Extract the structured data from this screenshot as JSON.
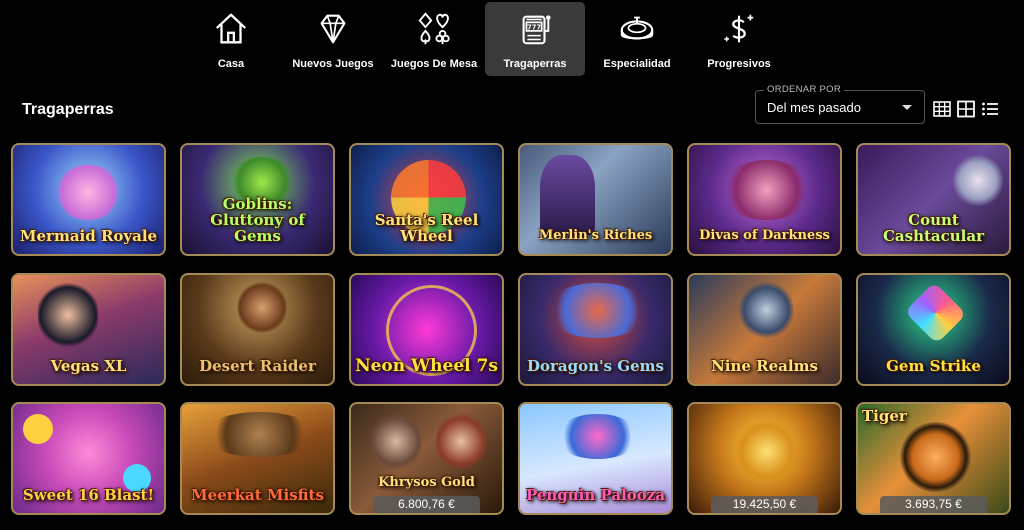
{
  "nav": {
    "items": [
      {
        "label": "Casa",
        "icon": "house-icon"
      },
      {
        "label": "Nuevos Juegos",
        "icon": "diamond-icon"
      },
      {
        "label": "Juegos De Mesa",
        "icon": "card-suits-icon"
      },
      {
        "label": "Tragaperras",
        "icon": "slot-machine-icon",
        "active": true
      },
      {
        "label": "Especialidad",
        "icon": "roulette-icon"
      },
      {
        "label": "Progresivos",
        "icon": "dollar-sparkle-icon"
      }
    ]
  },
  "page": {
    "title": "Tragaperras"
  },
  "sort": {
    "caption": "ORDENAR POR",
    "value": "Del mes pasado"
  },
  "view_options": [
    "grid-large-icon",
    "grid-small-icon",
    "list-view-icon"
  ],
  "games": [
    {
      "name": "Mermaid Royale"
    },
    {
      "name": "Goblins: Gluttony of Gems"
    },
    {
      "name": "Santa's Reel Wheel"
    },
    {
      "name": "Merlin's Riches"
    },
    {
      "name": "Divas of Darkness"
    },
    {
      "name": "Count Cashtacular"
    },
    {
      "name": "Vegas XL"
    },
    {
      "name": "Desert Raider"
    },
    {
      "name": "Neon Wheel 7s"
    },
    {
      "name": "Doragon's Gems"
    },
    {
      "name": "Nine Realms"
    },
    {
      "name": "Gem Strike"
    },
    {
      "name": "Sweet 16 Blast!"
    },
    {
      "name": "Meerkat Misfits"
    },
    {
      "name": "Khrysos Gold",
      "jackpot": "6.800,76 €"
    },
    {
      "name": "Penguin Palooza"
    },
    {
      "name": "",
      "jackpot": "19.425,50 €"
    },
    {
      "name": "Tiger",
      "jackpot": "3.693,75 €"
    }
  ],
  "colors": {
    "background": "#000000",
    "active_tab": "#3a3a3a",
    "tile_border": "#a58a55"
  }
}
